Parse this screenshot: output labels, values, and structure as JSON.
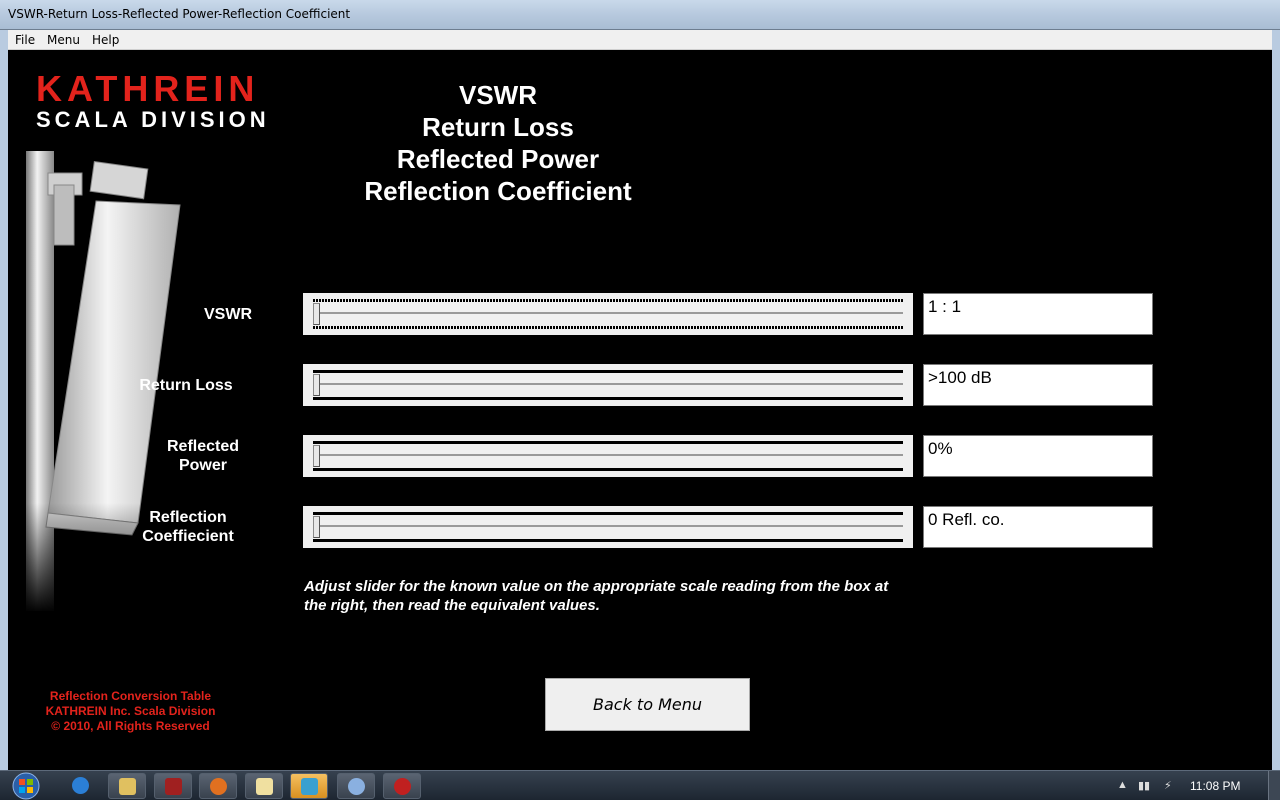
{
  "window": {
    "title": "VSWR-Return Loss-Reflected Power-Reflection Coefficient"
  },
  "menu": {
    "items": [
      "File",
      "Menu",
      "Help"
    ]
  },
  "logo": {
    "main": "KATHREIN",
    "sub": "SCALA DIVISION"
  },
  "heading": {
    "line1": "VSWR",
    "line2": "Return Loss",
    "line3": "Reflected Power",
    "line4": "Reflection Coefficient"
  },
  "rows": [
    {
      "label_line1": "VSWR",
      "label_line2": "",
      "value": "1 : 1",
      "slider_level": 0
    },
    {
      "label_line1": "Return Loss",
      "label_line2": "",
      "value": ">100 dB",
      "slider_level": 0
    },
    {
      "label_line1": "Reflected",
      "label_line2": "Power",
      "value": "0%",
      "slider_level": 0
    },
    {
      "label_line1": "Reflection",
      "label_line2": "Coeffiecient",
      "value": "0 Refl. co.",
      "slider_level": 0
    }
  ],
  "hint": "Adjust slider for the known value on the appropriate scale reading from the box at the right, then read the equivalent values.",
  "back_button": "Back to Menu",
  "footer": {
    "line1": "Reflection Conversion Table",
    "line2": "KATHREIN Inc.  Scala Division",
    "line3": "© 2010, All Rights Reserved"
  },
  "taskbar": {
    "clock": "11:08 PM",
    "accent": "#e3231c"
  }
}
